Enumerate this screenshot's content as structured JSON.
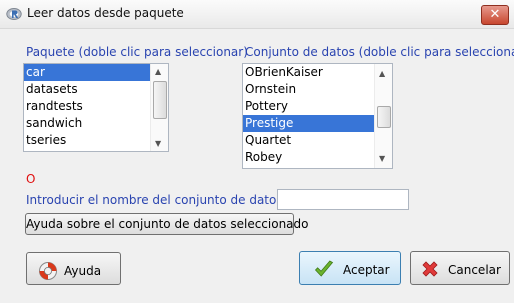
{
  "window": {
    "title": "Leer datos desde paquete",
    "close_glyph": "✕"
  },
  "packages": {
    "label": "Paquete (doble clic para seleccionar)",
    "items": [
      "car",
      "datasets",
      "randtests",
      "sandwich",
      "tseries"
    ],
    "selected": "car"
  },
  "datasets": {
    "label": "Conjunto de datos (doble clic para seleccionar)",
    "items": [
      "OBrienKaiser",
      "Ornstein",
      "Pottery",
      "Prestige",
      "Quartet",
      "Robey"
    ],
    "selected": "Prestige"
  },
  "error_indicator": "O",
  "entry": {
    "label": "Introducir el nombre del conjunto de datos:",
    "value": ""
  },
  "buttons": {
    "dataset_help": "Ayuda sobre el conjunto de datos seleccionado",
    "help": "Ayuda",
    "accept": "Aceptar",
    "cancel": "Cancelar"
  },
  "icons": {
    "app": "r-logo-icon",
    "help": "lifebuoy-icon",
    "accept": "checkmark-icon",
    "cancel": "red-x-icon"
  },
  "colors": {
    "label_blue": "#2a44b0",
    "selection": "#3875d7",
    "error_red": "#e01010"
  }
}
